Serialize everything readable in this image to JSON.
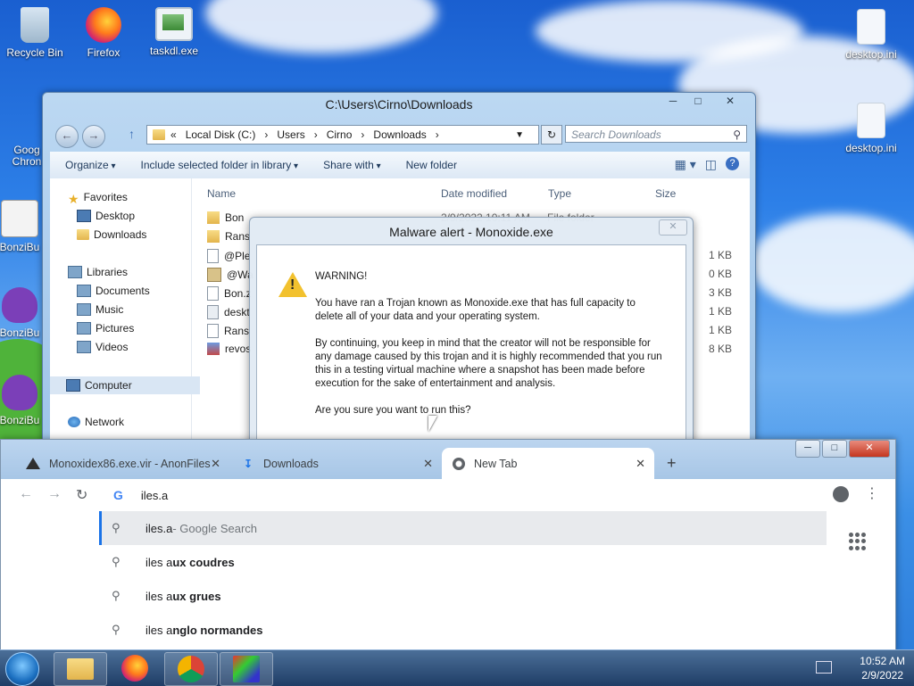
{
  "desktop": {
    "icons": [
      {
        "label": "Recycle Bin"
      },
      {
        "label": "Firefox"
      },
      {
        "label": "taskdl.exe"
      },
      {
        "label": "desktop.ini"
      },
      {
        "label": "desktop.ini"
      },
      {
        "label": "Goog Chron"
      },
      {
        "label": "BonziBu"
      },
      {
        "label": "BonziBu"
      },
      {
        "label": "BonziBu"
      }
    ]
  },
  "explorer": {
    "title": "C:\\Users\\Cirno\\Downloads",
    "path": [
      "«",
      "Local Disk (C:)",
      "›",
      "Users",
      "›",
      "Cirno",
      "›",
      "Downloads",
      "›"
    ],
    "search_placeholder": "Search Downloads",
    "commands": [
      "Organize",
      "Include selected folder in library",
      "Share with",
      "New folder"
    ],
    "nav": {
      "favorites": "Favorites",
      "desktop": "Desktop",
      "downloads": "Downloads",
      "libraries": "Libraries",
      "documents": "Documents",
      "music": "Music",
      "pictures": "Pictures",
      "videos": "Videos",
      "computer": "Computer",
      "network": "Network"
    },
    "columns": {
      "name": "Name",
      "date": "Date modified",
      "type": "Type",
      "size": "Size"
    },
    "files": [
      {
        "name": "Bon",
        "date": "2/9/2022 10:11 AM",
        "type": "File folder",
        "size": ""
      },
      {
        "name": "Rans",
        "date": "",
        "type": "",
        "size": ""
      },
      {
        "name": "@Ple",
        "date": "",
        "type": "",
        "size": "1 KB"
      },
      {
        "name": "@Wa",
        "date": "",
        "type": "",
        "size": "0 KB"
      },
      {
        "name": "Bon.z",
        "date": "",
        "type": "",
        "size": "3 KB"
      },
      {
        "name": "deskt",
        "date": "",
        "type": "",
        "size": "1 KB"
      },
      {
        "name": "Rans",
        "date": "",
        "type": "",
        "size": "1 KB"
      },
      {
        "name": "revos",
        "date": "",
        "type": "",
        "size": "8 KB"
      }
    ]
  },
  "dialog": {
    "title": "Malware alert - Monoxide.exe",
    "heading": "WARNING!",
    "p1": "You have ran a Trojan known as Monoxide.exe that has full capacity to delete all of your data and your operating system.",
    "p2": "By continuing, you keep in mind that the creator will not be responsible for any damage caused by this trojan and it is highly recommended that you run this in a testing virtual machine where a snapshot has been made before execution for the sake of entertainment and analysis.",
    "p3": "Are you sure you want to run this?"
  },
  "browser": {
    "tabs": [
      {
        "title": "Monoxidex86.exe.vir - AnonFiles"
      },
      {
        "title": "Downloads"
      },
      {
        "title": "New Tab"
      }
    ],
    "omnibox_value": "iles.a",
    "suggestions": [
      {
        "query": "iles.a",
        "suffix": " - Google Search"
      },
      {
        "prefix": "iles a",
        "bold": "ux coudres"
      },
      {
        "prefix": "iles a",
        "bold": "ux grues"
      },
      {
        "prefix": "iles a",
        "bold": "nglo normandes"
      }
    ]
  },
  "taskbar": {
    "time": "10:52 AM",
    "date": "2/9/2022"
  }
}
